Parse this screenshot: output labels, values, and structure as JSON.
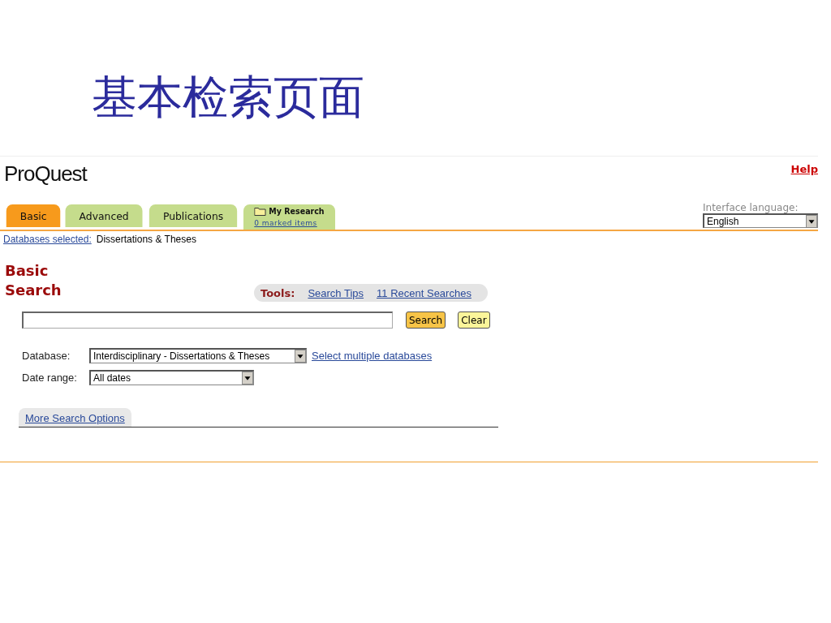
{
  "slide_title": "基本检索页面",
  "header": {
    "logo": "ProQuest",
    "help": "Help"
  },
  "tabs": [
    {
      "label": "Basic",
      "selected": true
    },
    {
      "label": "Advanced",
      "selected": false
    },
    {
      "label": "Publications",
      "selected": false
    },
    {
      "label": "My Research",
      "sublabel": "0 marked items",
      "selected": false
    }
  ],
  "language": {
    "label": "Interface language:",
    "value": "English"
  },
  "databases_selected": {
    "label": "Databases selected:",
    "value": "Dissertations & Theses"
  },
  "heading": "Basic Search",
  "tools": {
    "label": "Tools:",
    "links": [
      "Search Tips",
      "11 Recent Searches"
    ]
  },
  "search_buttons": [
    {
      "label": "Search",
      "kind": "primary"
    },
    {
      "label": "Clear",
      "kind": "secondary"
    }
  ],
  "fields": [
    {
      "label": "Database:",
      "value": "Interdisciplinary - Dissertations & Theses",
      "link": "Select multiple databases"
    },
    {
      "label": "Date range:",
      "value": "All dates"
    }
  ],
  "more_options": "More Search Options"
}
